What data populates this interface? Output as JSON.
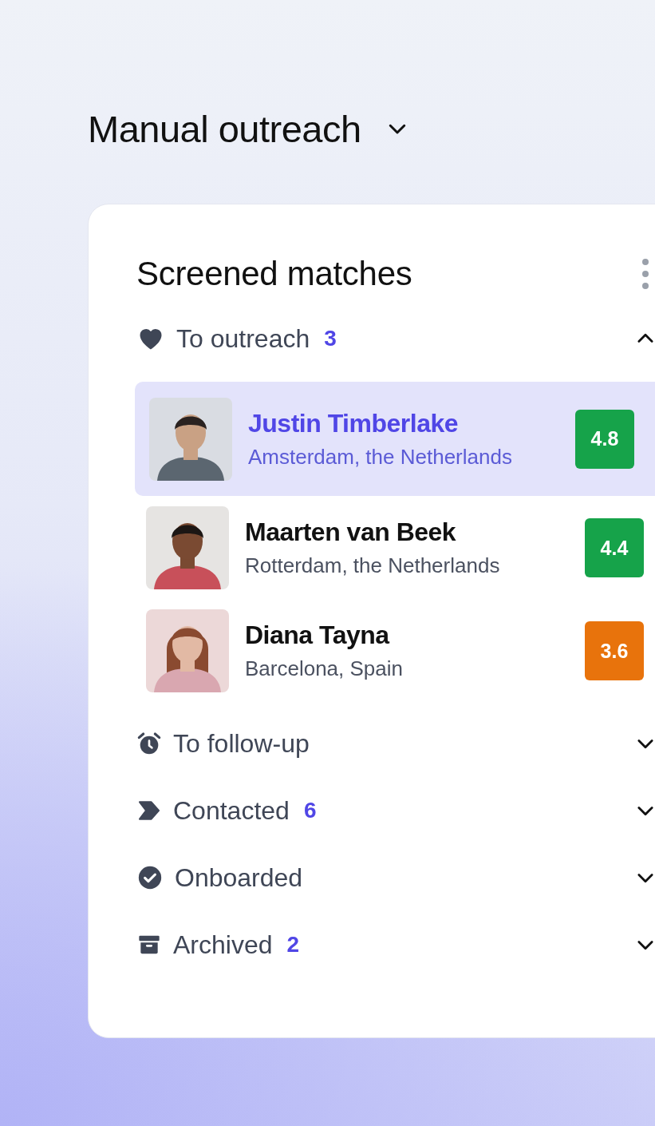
{
  "header": {
    "title": "Manual outreach"
  },
  "card": {
    "title": "Screened matches"
  },
  "sections": [
    {
      "kind": "heart",
      "label": "To outreach",
      "count": "3",
      "expanded": true,
      "matches": [
        {
          "name": "Justin Timberlake",
          "location": "Amsterdam, the Netherlands",
          "score": "4.8",
          "color": "#16a34a",
          "selected": true
        },
        {
          "name": "Maarten van Beek",
          "location": "Rotterdam, the Netherlands",
          "score": "4.4",
          "color": "#16a34a",
          "selected": false
        },
        {
          "name": "Diana Tayna",
          "location": "Barcelona, Spain",
          "score": "3.6",
          "color": "#e8730c",
          "selected": false
        }
      ]
    },
    {
      "kind": "alarm",
      "label": "To follow-up",
      "expanded": false
    },
    {
      "kind": "tag",
      "label": "Contacted",
      "count": "6",
      "expanded": false
    },
    {
      "kind": "check",
      "label": "Onboarded",
      "expanded": false
    },
    {
      "kind": "archive",
      "label": "Archived",
      "count": "2",
      "expanded": false
    }
  ]
}
